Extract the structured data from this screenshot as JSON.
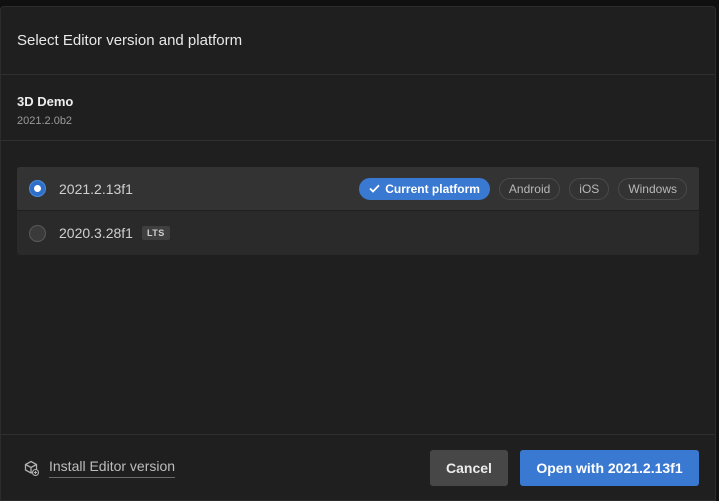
{
  "dialog": {
    "title": "Select Editor version and platform"
  },
  "project": {
    "name": "3D Demo",
    "version": "2021.2.0b2"
  },
  "versions": [
    {
      "label": "2021.2.13f1",
      "selected": true,
      "current_platform_label": "Current platform",
      "platforms": [
        "Android",
        "iOS",
        "Windows"
      ]
    },
    {
      "label": "2020.3.28f1",
      "selected": false,
      "badge": "LTS"
    }
  ],
  "footer": {
    "install_label": "Install Editor version",
    "cancel_label": "Cancel",
    "open_label": "Open with 2021.2.13f1"
  },
  "colors": {
    "accent": "#3a79d1",
    "background": "#1f1f1f"
  }
}
